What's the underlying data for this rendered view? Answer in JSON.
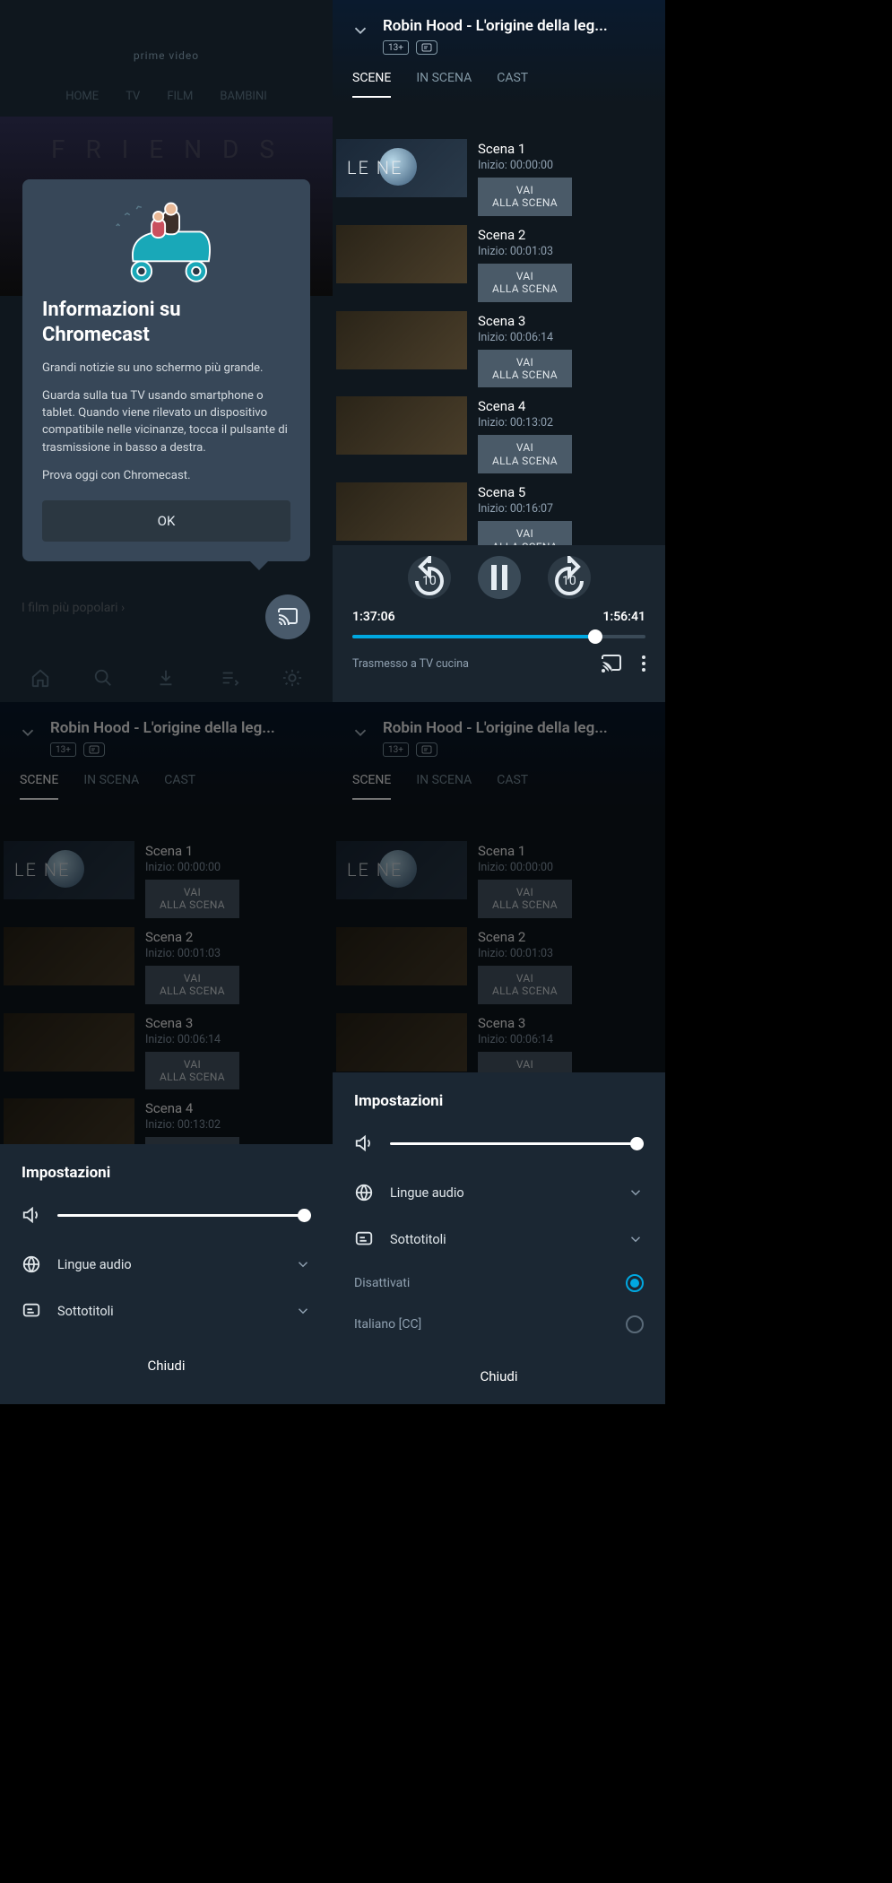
{
  "home": {
    "logo": "prime video",
    "nav": [
      "HOME",
      "TV",
      "FILM",
      "BAMBINI"
    ],
    "hero_title": "F R I E N D S",
    "section": "I film più popolari  ›"
  },
  "tooltip": {
    "title": "Informazioni su Chromecast",
    "p1": "Grandi notizie su uno schermo più grande.",
    "p2": "Guarda sulla tua TV usando smartphone o tablet. Quando viene rilevato un dispositivo compatibile nelle vicinanze, tocca il pulsante di trasmissione in basso a destra.",
    "p3": "Prova oggi con Chromecast.",
    "ok": "OK"
  },
  "player": {
    "title": "Robin Hood - L'origine della leg...",
    "rating": "13+",
    "tabs": {
      "scene": "SCENE",
      "in_scena": "IN SCENA",
      "cast": "CAST"
    },
    "scenes": [
      {
        "name": "Scena 1",
        "time": "Inizio: 00:00:00",
        "btn": "VAI ALLA SCENA",
        "cls": "leone"
      },
      {
        "name": "Scena 2",
        "time": "Inizio: 00:01:03",
        "btn": "VAI ALLA SCENA",
        "cls": "gen"
      },
      {
        "name": "Scena 3",
        "time": "Inizio: 00:06:14",
        "btn": "VAI ALLA SCENA",
        "cls": "gen"
      },
      {
        "name": "Scena 4",
        "time": "Inizio: 00:13:02",
        "btn": "VAI ALLA SCENA",
        "cls": "gen"
      },
      {
        "name": "Scena 5",
        "time": "Inizio: 00:16:07",
        "btn": "VAI ALLA SCENA",
        "cls": "gen"
      }
    ],
    "elapsed": "1:37:06",
    "total": "1:56:41",
    "progress_pct": 83,
    "cast_status": "Trasmesso a TV cucina"
  },
  "settings": {
    "title": "Impostazioni",
    "audio": "Lingue audio",
    "subtitles": "Sottotitoli",
    "close": "Chiudi",
    "sub_opts": [
      {
        "label": "Disattivati",
        "selected": true
      },
      {
        "label": "Italiano [CC]",
        "selected": false
      }
    ]
  }
}
